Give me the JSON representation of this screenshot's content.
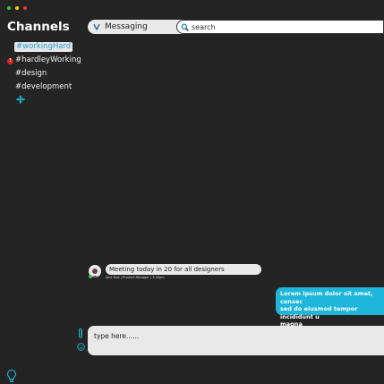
{
  "window_controls": {
    "close_color": "#ff5f56",
    "minimize_color": "#ffbd2e",
    "maximize_color": "#27c93f"
  },
  "sidebar": {
    "title": "Channels",
    "channels": [
      {
        "label": "#workingHard",
        "active": true
      },
      {
        "label": "#hardleyWorking",
        "unread": true,
        "badge": "!"
      },
      {
        "label": "#design"
      },
      {
        "label": "#development"
      }
    ],
    "add_icon": "add-channel-icon",
    "bottom_icon": "lightbulb-icon"
  },
  "header": {
    "room_name": "Messaging",
    "search_placeholder": "search"
  },
  "messages": {
    "incoming": {
      "text": "Meeting today in 20 for all designers",
      "meta": "Jane Doe | Product Manager | 3:40pm"
    },
    "outgoing": {
      "lines": [
        "Lorem ipsum dolor sit amet, consec",
        "sed do eiusmod tempor incididunt u",
        "magna"
      ]
    }
  },
  "composer": {
    "placeholder": "type here......"
  },
  "colors": {
    "background": "#242424",
    "accent": "#1eb6d9",
    "bubble": "#e9e9e9",
    "online": "#2ecc40",
    "alert": "#e02020"
  }
}
